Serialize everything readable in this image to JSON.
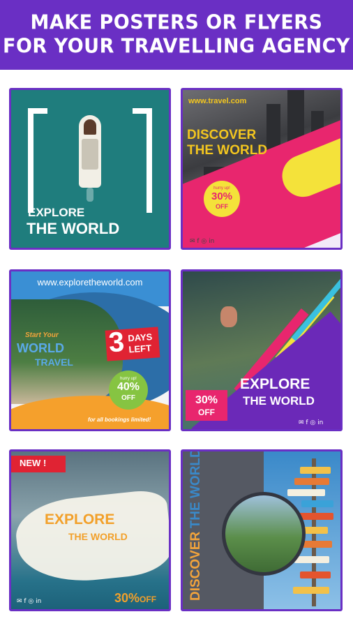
{
  "header": {
    "line1": "MAKE POSTERS OR FLYERS",
    "line2": "FOR YOUR TRAVELLING AGENCY",
    "background": "#6a2fc4"
  },
  "cards": [
    {
      "title_line1": "EXPLORE",
      "title_line2": "THE WORLD"
    },
    {
      "url": "www.travel.com",
      "title_line1": "DISCOVER",
      "title_line2": "THE WORLD",
      "badge_small": "hurry up!",
      "badge_pct": "30%",
      "badge_off": "OFF",
      "social": "✉ f ◎ in"
    },
    {
      "url": "www.exploretheworld.com",
      "script_text": "Start Your",
      "title_line1": "WORLD",
      "title_line2": "TRAVEL",
      "days_number": "3",
      "days_line1": "DAYS",
      "days_line2": "LEFT",
      "badge_small": "hurry up!",
      "badge_pct": "40%",
      "badge_off": "OFF",
      "footer": "for all bookings limited!"
    },
    {
      "title_line1": "EXPLORE",
      "title_line2": "THE WORLD",
      "badge_pct": "30%",
      "badge_off": "OFF",
      "social": "✉ f ◎ in"
    },
    {
      "ribbon": "NEW !",
      "title_line1": "EXPLORE",
      "title_line2": "THE WORLD",
      "pct": "30%",
      "off": "OFF",
      "social": "✉ f ◎ in"
    },
    {
      "vertical_word1": "DISCOVER",
      "vertical_word2": "THE WORLD"
    }
  ]
}
